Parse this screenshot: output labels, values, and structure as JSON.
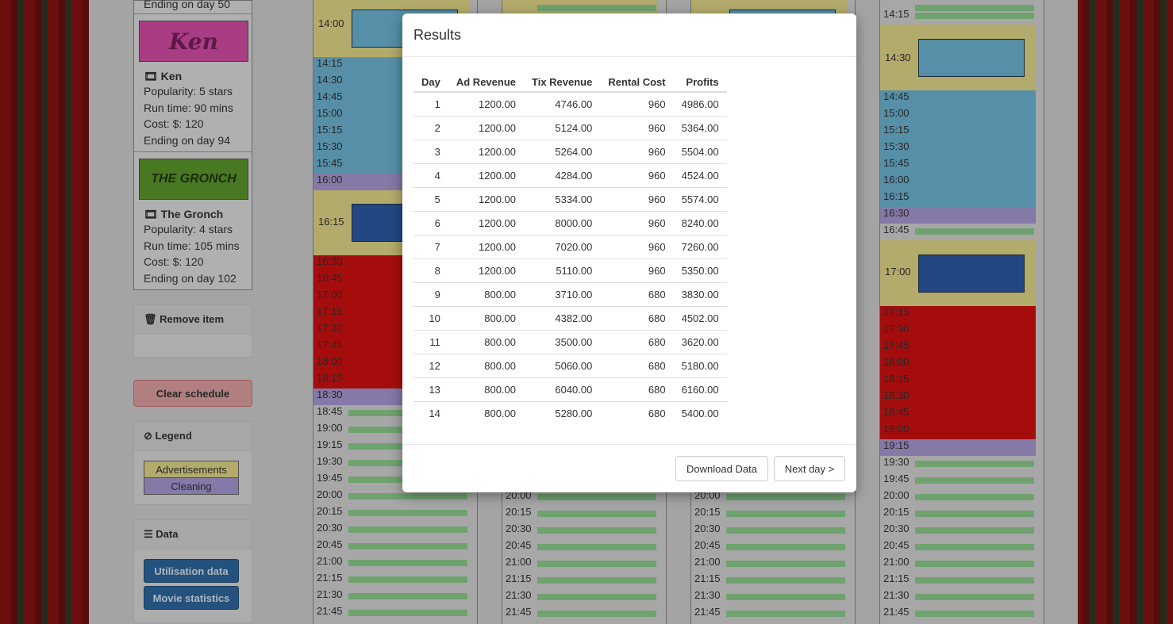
{
  "sidebar": {
    "first_item_tail": "Ending on day 50",
    "movies": [
      {
        "poster_text": "Ken",
        "title": "Ken",
        "popularity": "Popularity: 5 stars",
        "runtime": "Run time: 90 mins",
        "cost": "Cost: $: 120",
        "ending": "Ending on day 94",
        "poster_bg": "#d94fa8",
        "poster_fg": "#7a1f5a"
      },
      {
        "poster_text": "THE GRONCH",
        "title": "The Gronch",
        "popularity": "Popularity: 4 stars",
        "runtime": "Run time: 105 mins",
        "cost": "Cost: $: 120",
        "ending": "Ending on day 102",
        "poster_bg": "#5e9a2e",
        "poster_fg": "#20380f"
      }
    ],
    "remove_item": "Remove item",
    "clear_schedule": "Clear schedule",
    "legend_title": "Legend",
    "legend": [
      {
        "label": "Advertisements",
        "color": "#e6dc8a"
      },
      {
        "label": "Cleaning",
        "color": "#a99bd6"
      }
    ],
    "data_title": "Data",
    "utilisation": "Utilisation data",
    "movie_stats": "Movie statistics"
  },
  "schedule": {
    "col1_times": [
      "14:00",
      "14:15",
      "14:30",
      "14:45",
      "15:00",
      "15:15",
      "15:30",
      "15:45",
      "16:00",
      "16:15",
      "16:30",
      "16:45",
      "17:00",
      "17:15",
      "17:30",
      "17:45",
      "18:00",
      "18:15",
      "18:30",
      "18:45",
      "19:00",
      "19:15",
      "19:30",
      "19:45",
      "20:00",
      "20:15",
      "20:30",
      "20:45",
      "21:00",
      "21:15",
      "21:30",
      "21:45"
    ],
    "col4_times": [
      "14:15",
      "14:30",
      "14:45",
      "15:00",
      "15:15",
      "15:30",
      "15:45",
      "16:00",
      "16:15",
      "16:30",
      "16:45",
      "17:00",
      "17:15",
      "17:30",
      "17:45",
      "18:00",
      "18:15",
      "18:30",
      "18:45",
      "19:00",
      "19:15",
      "19:30",
      "19:45",
      "20:00",
      "20:15",
      "20:30",
      "20:45",
      "21:00",
      "21:15",
      "21:30",
      "21:45"
    ],
    "late_times": [
      "20:00",
      "20:15",
      "20:30",
      "20:45",
      "21:00",
      "21:15",
      "21:30",
      "21:45"
    ],
    "top_time": "14:00"
  },
  "modal": {
    "title": "Results",
    "headers": [
      "Day",
      "Ad Revenue",
      "Tix Revenue",
      "Rental Cost",
      "Profits"
    ],
    "rows": [
      [
        "1",
        "1200.00",
        "4746.00",
        "960",
        "4986.00"
      ],
      [
        "2",
        "1200.00",
        "5124.00",
        "960",
        "5364.00"
      ],
      [
        "3",
        "1200.00",
        "5264.00",
        "960",
        "5504.00"
      ],
      [
        "4",
        "1200.00",
        "4284.00",
        "960",
        "4524.00"
      ],
      [
        "5",
        "1200.00",
        "5334.00",
        "960",
        "5574.00"
      ],
      [
        "6",
        "1200.00",
        "8000.00",
        "960",
        "8240.00"
      ],
      [
        "7",
        "1200.00",
        "7020.00",
        "960",
        "7260.00"
      ],
      [
        "8",
        "1200.00",
        "5110.00",
        "960",
        "5350.00"
      ],
      [
        "9",
        "800.00",
        "3710.00",
        "680",
        "3830.00"
      ],
      [
        "10",
        "800.00",
        "4382.00",
        "680",
        "4502.00"
      ],
      [
        "11",
        "800.00",
        "3500.00",
        "680",
        "3620.00"
      ],
      [
        "12",
        "800.00",
        "5060.00",
        "680",
        "5180.00"
      ],
      [
        "13",
        "800.00",
        "6040.00",
        "680",
        "6160.00"
      ],
      [
        "14",
        "800.00",
        "5280.00",
        "680",
        "5400.00"
      ]
    ],
    "download": "Download Data",
    "next_day": "Next day >"
  }
}
